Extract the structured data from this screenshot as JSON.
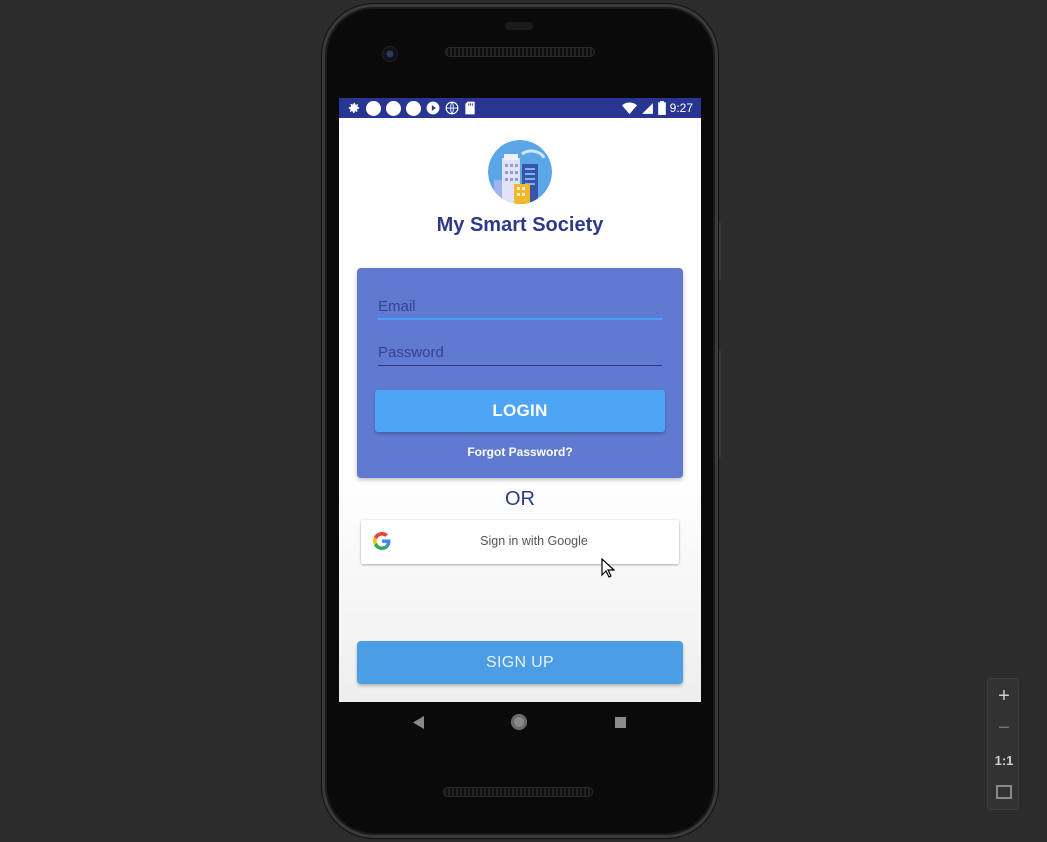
{
  "statusbar": {
    "time": "9:27",
    "left_icons": [
      "settings-icon",
      "notification-dot-icon",
      "notification-dot-icon",
      "notification-dot-icon",
      "play-icon",
      "globe-icon",
      "sd-card-icon"
    ],
    "right_icons": [
      "wifi-icon",
      "cell-signal-icon",
      "battery-icon"
    ],
    "color": "#283593"
  },
  "app": {
    "title": "My Smart Society",
    "logo_icon": "city-buildings-icon"
  },
  "login": {
    "email_placeholder": "Email",
    "password_placeholder": "Password",
    "login_label": "LOGIN",
    "forgot_label": "Forgot Password?",
    "card_color": "#5f7ad0",
    "button_color": "#4fa5f5"
  },
  "divider": {
    "or_label": "OR"
  },
  "google": {
    "label": "Sign in with Google",
    "icon": "google-g-icon"
  },
  "signup": {
    "label": "SIGN UP",
    "color": "#4b9de6"
  },
  "navbar": {
    "icons": [
      "back-icon",
      "home-icon",
      "recents-icon"
    ]
  },
  "emulator": {
    "zoom_in": "+",
    "zoom_out": "−",
    "actual_size": "1:1",
    "fit_icon": "fit-screen-icon"
  }
}
